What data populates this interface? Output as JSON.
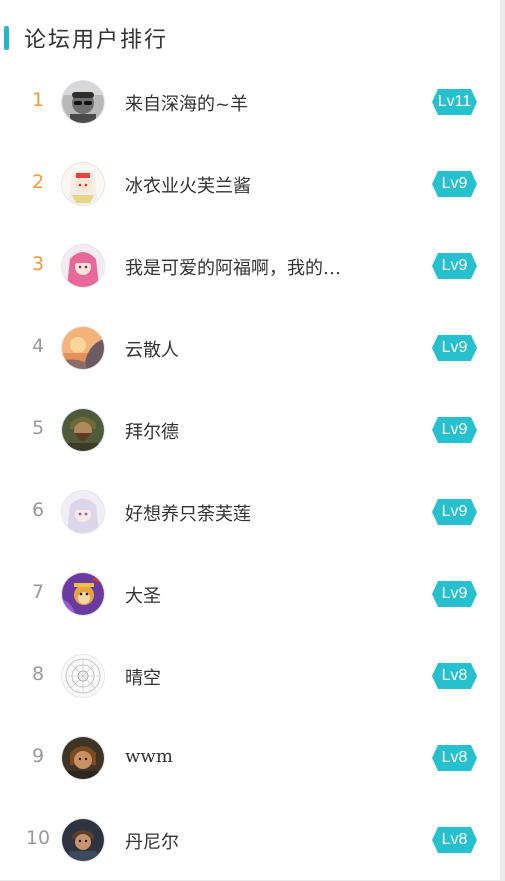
{
  "header": {
    "title": "论坛用户排行"
  },
  "colors": {
    "accent": "#22b8c7",
    "badge": "#26c0cf",
    "rank_top": "#f29a3c",
    "rank_default": "#999999"
  },
  "rankings": [
    {
      "rank": "1",
      "name": "来自深海的~羊",
      "level": "Lv11",
      "avatar": "avatar-bw-sunglasses"
    },
    {
      "rank": "2",
      "name": "冰衣业火芙兰酱",
      "level": "Lv9",
      "avatar": "avatar-anime-white-hair"
    },
    {
      "rank": "3",
      "name": "我是可爱的阿福啊，我的…",
      "level": "Lv9",
      "avatar": "avatar-anime-pink-hair"
    },
    {
      "rank": "4",
      "name": "云散人",
      "level": "Lv9",
      "avatar": "avatar-sunset-sky"
    },
    {
      "rank": "5",
      "name": "拜尔德",
      "level": "Lv9",
      "avatar": "avatar-bearded-warrior"
    },
    {
      "rank": "6",
      "name": "好想养只荼芙莲",
      "level": "Lv9",
      "avatar": "avatar-anime-silver-hair"
    },
    {
      "rank": "7",
      "name": "大圣",
      "level": "Lv9",
      "avatar": "avatar-monkey-king"
    },
    {
      "rank": "8",
      "name": "晴空",
      "level": "Lv8",
      "avatar": "avatar-mandala"
    },
    {
      "rank": "9",
      "name": "wwm",
      "level": "Lv8",
      "avatar": "avatar-painted-portrait"
    },
    {
      "rank": "10",
      "name": "丹尼尔",
      "level": "Lv8",
      "avatar": "avatar-soldier-portrait"
    }
  ]
}
